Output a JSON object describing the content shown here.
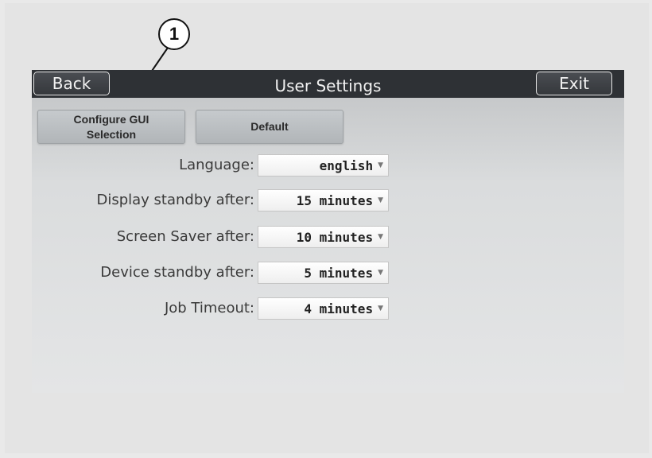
{
  "callout": {
    "number": "1"
  },
  "titlebar": {
    "back_label": "Back",
    "title": "User Settings",
    "exit_label": "Exit"
  },
  "toolbar": {
    "configure_gui_label": "Configure GUI\nSelection",
    "default_label": "Default"
  },
  "settings": [
    {
      "label": "Language:",
      "value": "english"
    },
    {
      "label": "Display standby after:",
      "value": "15 minutes"
    },
    {
      "label": "Screen Saver after:",
      "value": "10 minutes"
    },
    {
      "label": "Device standby after:",
      "value": "5 minutes"
    },
    {
      "label": "Job Timeout:",
      "value": "4 minutes"
    }
  ],
  "icons": {
    "dropdown": "chevron-down-icon"
  },
  "colors": {
    "titlebar_bg": "#2e3135",
    "button_bg": "#c0c4c7",
    "page_bg": "#e4e4e4"
  }
}
